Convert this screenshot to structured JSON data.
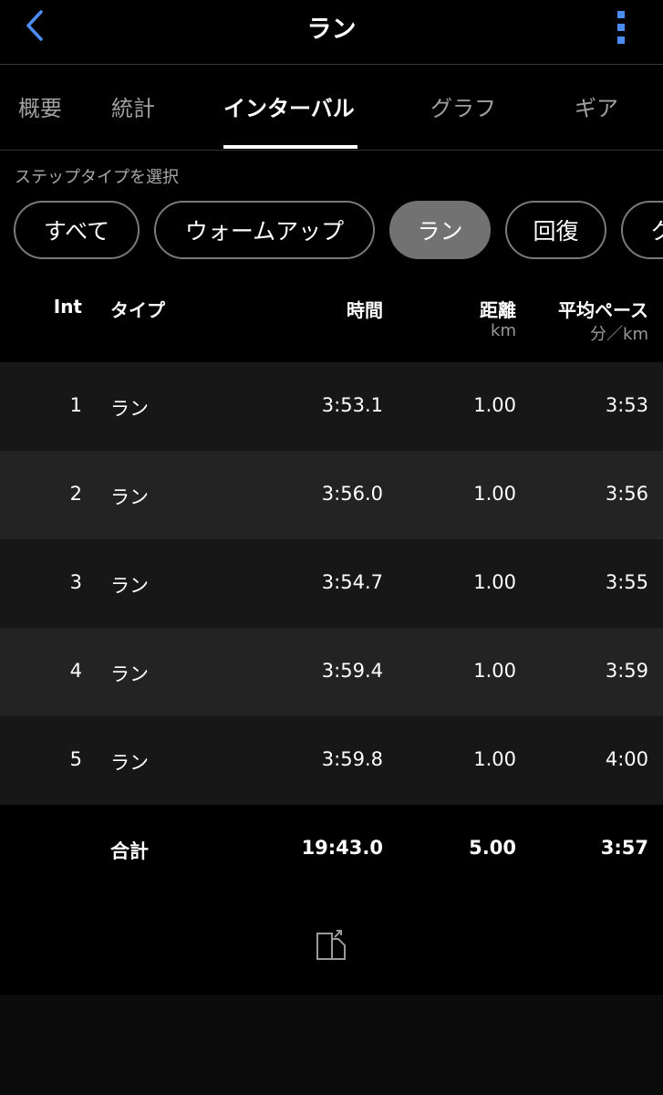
{
  "header": {
    "title": "ラン",
    "back_icon": "chevron-left-icon",
    "more_icon": "more-vertical-icon",
    "accent_color": "#4c8cf5"
  },
  "tabs": [
    {
      "label": "概要",
      "active": false
    },
    {
      "label": "統計",
      "active": false
    },
    {
      "label": "インターバル",
      "active": true
    },
    {
      "label": "グラフ",
      "active": false
    },
    {
      "label": "ギア",
      "active": false
    }
  ],
  "step_filter": {
    "label": "ステップタイプを選択",
    "chips": [
      {
        "label": "すべて",
        "selected": false
      },
      {
        "label": "ウォームアップ",
        "selected": false
      },
      {
        "label": "ラン",
        "selected": true
      },
      {
        "label": "回復",
        "selected": false
      },
      {
        "label": "ク",
        "selected": false
      }
    ]
  },
  "table": {
    "columns": {
      "int": "Int",
      "type": "タイプ",
      "time": "時間",
      "distance": "距離",
      "distance_unit": "km",
      "pace": "平均ペース",
      "pace_unit": "分／km"
    },
    "rows": [
      {
        "int": "1",
        "type": "ラン",
        "time": "3:53.1",
        "distance": "1.00",
        "pace": "3:53"
      },
      {
        "int": "2",
        "type": "ラン",
        "time": "3:56.0",
        "distance": "1.00",
        "pace": "3:56"
      },
      {
        "int": "3",
        "type": "ラン",
        "time": "3:54.7",
        "distance": "1.00",
        "pace": "3:55"
      },
      {
        "int": "4",
        "type": "ラン",
        "time": "3:59.4",
        "distance": "1.00",
        "pace": "3:59"
      },
      {
        "int": "5",
        "type": "ラン",
        "time": "3:59.8",
        "distance": "1.00",
        "pace": "4:00"
      }
    ],
    "total": {
      "label": "合計",
      "time": "19:43.0",
      "distance": "5.00",
      "pace": "3:57"
    }
  },
  "footer": {
    "export_icon": "export-document-icon"
  }
}
